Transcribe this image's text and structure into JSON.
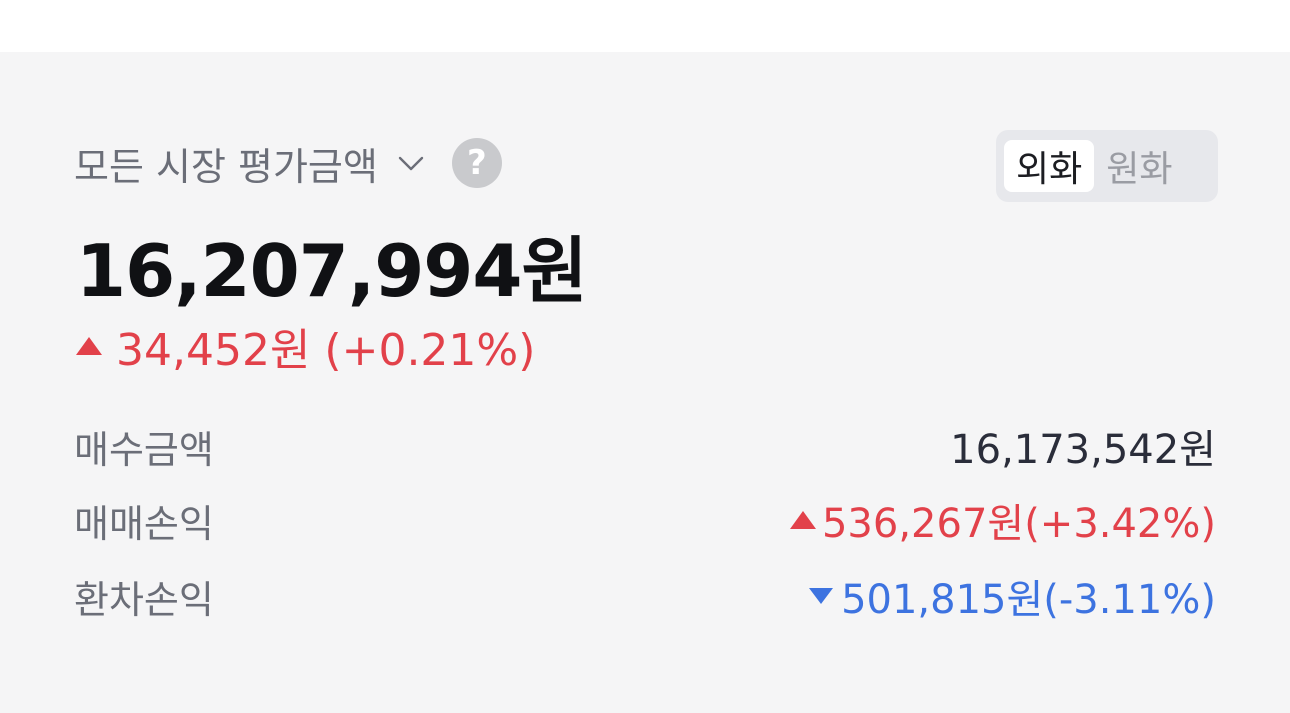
{
  "summary": {
    "market_label": "모든 시장 평가금액",
    "help_glyph": "?",
    "currency_toggle": {
      "options": [
        "외화",
        "원화"
      ],
      "selected": "외화"
    },
    "total_value": "16,207,994원",
    "change_text": "34,452원 (+0.21%)",
    "change_direction": "up"
  },
  "details": [
    {
      "label": "매수금액",
      "value": "16,173,542원",
      "direction": "none"
    },
    {
      "label": "매매손익",
      "value": "536,267원(+3.42%)",
      "direction": "up"
    },
    {
      "label": "환차손익",
      "value": "501,815원(-3.11%)",
      "direction": "down"
    }
  ],
  "colors": {
    "up": "#e2414a",
    "down": "#3d73e0",
    "label": "#6b6e78",
    "background": "#f5f5f6"
  },
  "icons": {
    "chevron": "chevron-down-icon",
    "help": "help-icon",
    "up": "triangle-up-icon",
    "down": "triangle-down-icon"
  }
}
